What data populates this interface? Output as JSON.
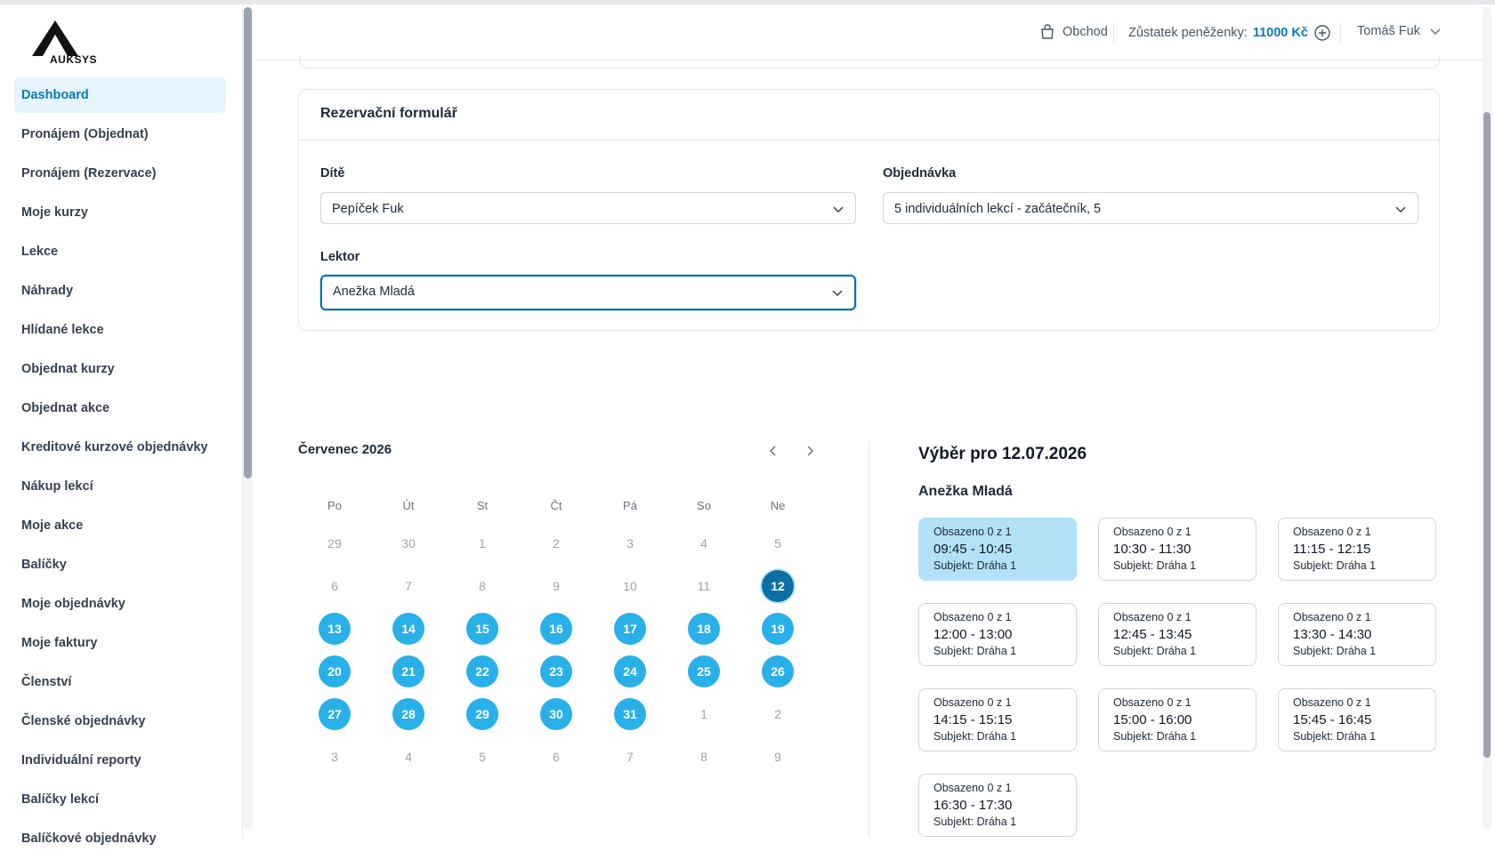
{
  "app": {
    "logo_text": "AUKSYS"
  },
  "sidebar": {
    "items": [
      {
        "label": "Dashboard",
        "active": true
      },
      {
        "label": "Pronájem (Objednat)"
      },
      {
        "label": "Pronájem (Rezervace)"
      },
      {
        "label": "Moje kurzy"
      },
      {
        "label": "Lekce"
      },
      {
        "label": "Náhrady"
      },
      {
        "label": "Hlídané lekce"
      },
      {
        "label": "Objednat kurzy"
      },
      {
        "label": "Objednat akce"
      },
      {
        "label": "Kreditové kurzové objednávky"
      },
      {
        "label": "Nákup lekcí"
      },
      {
        "label": "Moje akce"
      },
      {
        "label": "Balíčky"
      },
      {
        "label": "Moje objednávky"
      },
      {
        "label": "Moje faktury"
      },
      {
        "label": "Členství"
      },
      {
        "label": "Členské objednávky"
      },
      {
        "label": "Individuální reporty"
      },
      {
        "label": "Balíčky lekcí"
      },
      {
        "label": "Balíčkové objednávky"
      }
    ]
  },
  "header": {
    "shop_label": "Obchod",
    "wallet_label": "Zůstatek peněženky:",
    "wallet_amount": "11000 Kč",
    "user_name": "Tomáš Fuk"
  },
  "form": {
    "title": "Rezervační formulář",
    "child_label": "Dítě",
    "child_value": "Pepíček Fuk",
    "order_label": "Objednávka",
    "order_value": "5 individuálních lekcí - začátečník, 5",
    "lector_label": "Lektor",
    "lector_value": "Anežka Mladá"
  },
  "calendar": {
    "month_label": "Červenec 2026",
    "weekdays": [
      "Po",
      "Út",
      "St",
      "Čt",
      "Pá",
      "So",
      "Ne"
    ],
    "weeks": [
      [
        {
          "d": "29"
        },
        {
          "d": "30"
        },
        {
          "d": "1"
        },
        {
          "d": "2"
        },
        {
          "d": "3"
        },
        {
          "d": "4"
        },
        {
          "d": "5"
        }
      ],
      [
        {
          "d": "6"
        },
        {
          "d": "7"
        },
        {
          "d": "8"
        },
        {
          "d": "9"
        },
        {
          "d": "10"
        },
        {
          "d": "11"
        },
        {
          "d": "12",
          "s": "sel"
        }
      ],
      [
        {
          "d": "13",
          "s": "avail"
        },
        {
          "d": "14",
          "s": "avail"
        },
        {
          "d": "15",
          "s": "avail"
        },
        {
          "d": "16",
          "s": "avail"
        },
        {
          "d": "17",
          "s": "avail"
        },
        {
          "d": "18",
          "s": "avail"
        },
        {
          "d": "19",
          "s": "avail"
        }
      ],
      [
        {
          "d": "20",
          "s": "avail"
        },
        {
          "d": "21",
          "s": "avail"
        },
        {
          "d": "22",
          "s": "avail"
        },
        {
          "d": "23",
          "s": "avail"
        },
        {
          "d": "24",
          "s": "avail"
        },
        {
          "d": "25",
          "s": "avail"
        },
        {
          "d": "26",
          "s": "avail"
        }
      ],
      [
        {
          "d": "27",
          "s": "avail"
        },
        {
          "d": "28",
          "s": "avail"
        },
        {
          "d": "29",
          "s": "avail"
        },
        {
          "d": "30",
          "s": "avail"
        },
        {
          "d": "31",
          "s": "avail"
        },
        {
          "d": "1"
        },
        {
          "d": "2"
        }
      ],
      [
        {
          "d": "3"
        },
        {
          "d": "4"
        },
        {
          "d": "5"
        },
        {
          "d": "6"
        },
        {
          "d": "7"
        },
        {
          "d": "8"
        },
        {
          "d": "9"
        }
      ]
    ]
  },
  "selection": {
    "title": "Výběr pro 12.07.2026",
    "lector": "Anežka Mladá",
    "slots": [
      {
        "occupancy": "Obsazeno 0 z 1",
        "time": "09:45 - 10:45",
        "subject": "Subjekt: Dráha 1",
        "selected": true
      },
      {
        "occupancy": "Obsazeno 0 z 1",
        "time": "10:30 - 11:30",
        "subject": "Subjekt: Dráha 1"
      },
      {
        "occupancy": "Obsazeno 0 z 1",
        "time": "11:15 - 12:15",
        "subject": "Subjekt: Dráha 1"
      },
      {
        "occupancy": "Obsazeno 0 z 1",
        "time": "12:00 - 13:00",
        "subject": "Subjekt: Dráha 1"
      },
      {
        "occupancy": "Obsazeno 0 z 1",
        "time": "12:45 - 13:45",
        "subject": "Subjekt: Dráha 1"
      },
      {
        "occupancy": "Obsazeno 0 z 1",
        "time": "13:30 - 14:30",
        "subject": "Subjekt: Dráha 1"
      },
      {
        "occupancy": "Obsazeno 0 z 1",
        "time": "14:15 - 15:15",
        "subject": "Subjekt: Dráha 1"
      },
      {
        "occupancy": "Obsazeno 0 z 1",
        "time": "15:00 - 16:00",
        "subject": "Subjekt: Dráha 1"
      },
      {
        "occupancy": "Obsazeno 0 z 1",
        "time": "15:45 - 16:45",
        "subject": "Subjekt: Dráha 1"
      },
      {
        "occupancy": "Obsazeno 0 z 1",
        "time": "16:30 - 17:30",
        "subject": "Subjekt: Dráha 1"
      }
    ]
  }
}
